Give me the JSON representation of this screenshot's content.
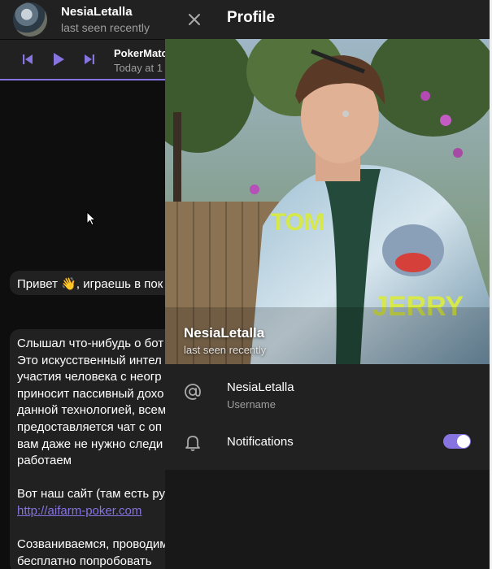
{
  "chat": {
    "header": {
      "name": "NesiaLetalla",
      "status": "last seen recently"
    },
    "player": {
      "title": "PokerMatc",
      "subtitle": "Today at 1"
    },
    "messages": [
      {
        "text": "Привет 👋, играешь в пок"
      },
      {
        "lines": [
          "Слышал что-нибудь о бот",
          "Это искусственный интел",
          "участия человека с неогр",
          "приносит пассивный дохо",
          "данной технологией, всем",
          "предоставляется чат с оп",
          "вам даже не нужно следи",
          "работаем"
        ],
        "site_line": "Вот наш сайт (там есть ру",
        "link": "http://aifarm-poker.com",
        "tail_lines": [
          "Созваниваемся, проводим",
          "бесплатно попробовать"
        ]
      }
    ]
  },
  "profile": {
    "title": "Profile",
    "name": "NesiaLetalla",
    "status": "last seen recently",
    "username": {
      "value": "NesiaLetalla",
      "caption": "Username"
    },
    "notifications": {
      "label": "Notifications",
      "enabled": true
    }
  },
  "colors": {
    "accent": "#8774e1",
    "panel": "#212121",
    "background": "#0f0f0f"
  }
}
